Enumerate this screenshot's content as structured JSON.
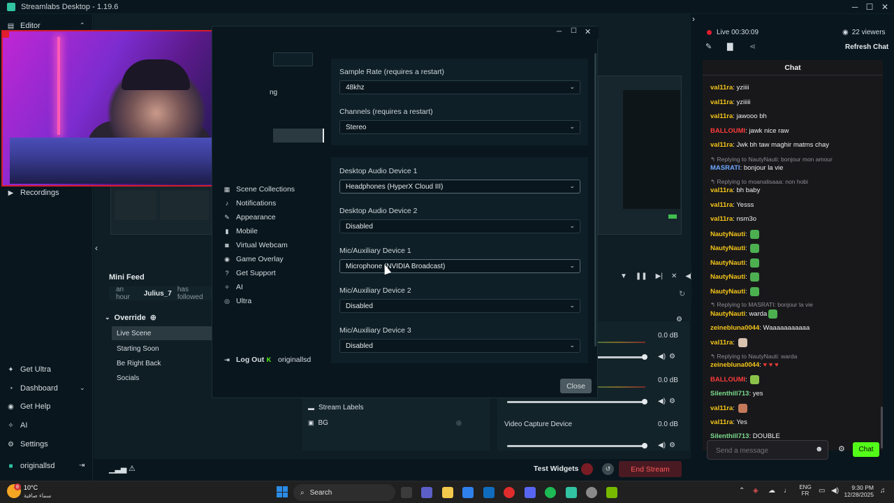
{
  "app": {
    "title": "Streamlabs Desktop - 1.19.6"
  },
  "left_nav": {
    "editor": "Editor",
    "recordings": "Recordings",
    "get_ultra": "Get Ultra",
    "dashboard": "Dashboard",
    "get_help": "Get Help",
    "ai": "AI",
    "settings": "Settings",
    "user": "originallsd"
  },
  "mini_feed": {
    "title": "Mini Feed",
    "time": "an hour",
    "user": "Julius_7",
    "action": "has followed"
  },
  "scenes": {
    "collection": "Override",
    "items": [
      "Live Scene",
      "Starting Soon",
      "Be Right Back",
      "Socials"
    ]
  },
  "sources": {
    "items": [
      "Stream Labels",
      "BG"
    ]
  },
  "mixer": {
    "rows": [
      {
        "name": "",
        "level": "0.0 dB"
      },
      {
        "name": "",
        "level": "0.0 dB"
      },
      {
        "name": "Video Capture Device",
        "level": "0.0 dB"
      }
    ]
  },
  "footer": {
    "test_widgets": "Test Widgets",
    "end_stream": "End Stream"
  },
  "settings_modal": {
    "sidebar": {
      "partial_top": "ng",
      "items": [
        "Scene Collections",
        "Notifications",
        "Appearance",
        "Mobile",
        "Virtual Webcam",
        "Game Overlay",
        "Get Support",
        "AI",
        "Ultra"
      ],
      "log_out": "Log Out",
      "user": "originallsd"
    },
    "fields": [
      {
        "label": "Sample Rate (requires a restart)",
        "value": "48khz"
      },
      {
        "label": "Channels (requires a restart)",
        "value": "Stereo"
      },
      {
        "label": "Desktop Audio Device 1",
        "value": "Headphones (HyperX Cloud III)"
      },
      {
        "label": "Desktop Audio Device 2",
        "value": "Disabled"
      },
      {
        "label": "Mic/Auxiliary Device 1",
        "value": "Microphone (NVIDIA Broadcast)"
      },
      {
        "label": "Mic/Auxiliary Device 2",
        "value": "Disabled"
      },
      {
        "label": "Mic/Auxiliary Device 3",
        "value": "Disabled"
      }
    ],
    "close": "Close"
  },
  "live": {
    "status": "Live 00:30:09",
    "viewers": "22 viewers",
    "refresh_chat": "Refresh Chat",
    "chat_title": "Chat"
  },
  "chat": {
    "messages": [
      {
        "user": "val11ra",
        "text": "yziiii",
        "color": "#f5c518"
      },
      {
        "user": "val11ra",
        "text": "yziiiii",
        "color": "#f5c518"
      },
      {
        "user": "val11ra",
        "text": "jawooo bh",
        "color": "#f5c518"
      },
      {
        "user": "BALLOUMI",
        "text": "jawk nice raw",
        "color": "#ff3b3b"
      },
      {
        "user": "val11ra",
        "text": "Jwk bh taw maghir matms chay",
        "color": "#f5c518"
      },
      {
        "reply": "Replying to NautyNauti: bonjour mon amour"
      },
      {
        "user": "MASRATI",
        "text": "bonjour la vie",
        "color": "#6fa8ff"
      },
      {
        "reply": "Replying to moanalisaaa: non hobi"
      },
      {
        "user": "val11ra",
        "text": "bh baby",
        "color": "#f5c518"
      },
      {
        "user": "val11ra",
        "text": "Yesss",
        "color": "#f5c518"
      },
      {
        "user": "val11ra",
        "text": "nsm3o",
        "color": "#f5c518"
      },
      {
        "user": "NautyNauti",
        "text": "",
        "color": "#f5c518",
        "emote": "#4caf50"
      },
      {
        "user": "NautyNauti",
        "text": "",
        "color": "#f5c518",
        "emote": "#4caf50"
      },
      {
        "user": "NautyNauti",
        "text": "",
        "color": "#f5c518",
        "emote": "#4caf50"
      },
      {
        "user": "NautyNauti",
        "text": "",
        "color": "#f5c518",
        "emote": "#4caf50"
      },
      {
        "user": "NautyNauti",
        "text": "",
        "color": "#f5c518",
        "emote": "#4caf50"
      },
      {
        "reply": "Replying to MASRATI: bonjour la vie"
      },
      {
        "user": "NautyNauti",
        "text": "warda",
        "color": "#f5c518",
        "emote": "#4caf50"
      },
      {
        "user": "zeinebluna0044",
        "text": "Waaaaaaaaaaa",
        "color": "#f5c518"
      },
      {
        "user": "val11ra",
        "text": "",
        "color": "#f5c518",
        "emote": "#d9c2b0"
      },
      {
        "reply": "Replying to NautyNauti: warda"
      },
      {
        "user": "zeinebluna0044",
        "text": "♥ ♥ ♥",
        "color": "#f5c518"
      },
      {
        "user": "BALLOUMI",
        "text": "",
        "color": "#ff3b3b",
        "emote": "#8bc34a"
      },
      {
        "user": "Silenthill713",
        "text": "yes",
        "color": "#7bdc8b"
      },
      {
        "user": "val11ra",
        "text": "",
        "color": "#f5c518",
        "emote": "#c47a5a"
      },
      {
        "user": "val11ra",
        "text": "Yes",
        "color": "#f5c518"
      },
      {
        "user": "Silenthill713",
        "text": "DOUBLE",
        "color": "#7bdc8b"
      }
    ],
    "input_placeholder": "Send a message",
    "send": "Chat"
  },
  "taskbar": {
    "weather_temp": "10°C",
    "weather_desc": "سماء صافية",
    "badge": "8",
    "search": "Search",
    "lang_top": "ENG",
    "lang_bottom": "FR",
    "time": "9:30 PM",
    "date": "12/28/2025"
  }
}
